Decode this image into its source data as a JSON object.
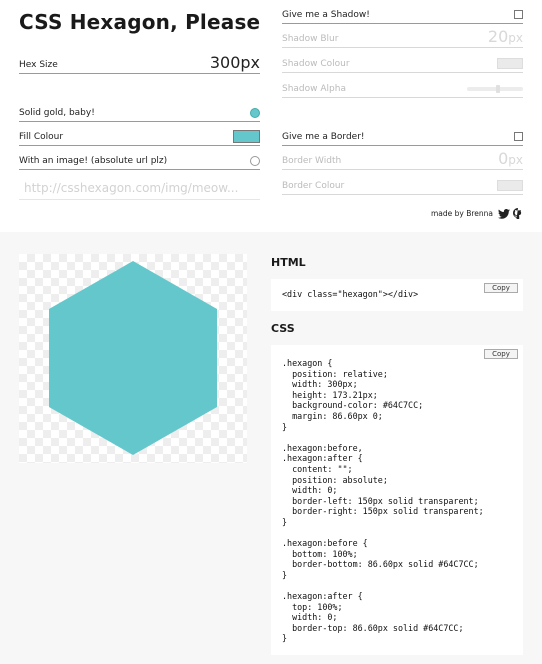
{
  "app": {
    "title": "CSS Hexagon, Please"
  },
  "controls": {
    "hex_size": {
      "label": "Hex Size",
      "value": "300px"
    },
    "solid": {
      "label": "Solid gold, baby!"
    },
    "fill_colour": {
      "label": "Fill Colour",
      "color": "#64C7CC"
    },
    "with_image": {
      "label": "With an image! (absolute url plz)",
      "placeholder": "http://csshexagon.com/img/meow..."
    },
    "shadow": {
      "label": "Give me a Shadow!"
    },
    "shadow_blur": {
      "label": "Shadow Blur",
      "value": "20",
      "unit": "px"
    },
    "shadow_colour": {
      "label": "Shadow Colour"
    },
    "shadow_alpha": {
      "label": "Shadow Alpha",
      "level": 0.55
    },
    "border": {
      "label": "Give me a Border!"
    },
    "border_width": {
      "label": "Border Width",
      "value": "0",
      "unit": "px"
    },
    "border_colour": {
      "label": "Border Colour"
    }
  },
  "credit": {
    "text": "made by Brenna",
    "icons": [
      "twitter-icon",
      "github-icon"
    ]
  },
  "output": {
    "html_title": "HTML",
    "html_code": "<div class=\"hexagon\"></div>",
    "css_title": "CSS",
    "copy_label": "Copy",
    "css_code": ".hexagon {\n  position: relative;\n  width: 300px;\n  height: 173.21px;\n  background-color: #64C7CC;\n  margin: 86.60px 0;\n}\n\n.hexagon:before,\n.hexagon:after {\n  content: \"\";\n  position: absolute;\n  width: 0;\n  border-left: 150px solid transparent;\n  border-right: 150px solid transparent;\n}\n\n.hexagon:before {\n  bottom: 100%;\n  border-bottom: 86.60px solid #64C7CC;\n}\n\n.hexagon:after {\n  top: 100%;\n  width: 0;\n  border-top: 86.60px solid #64C7CC;\n}"
  },
  "colors": {
    "hexagon": "#64C7CC",
    "accent": "#64C7CC"
  }
}
